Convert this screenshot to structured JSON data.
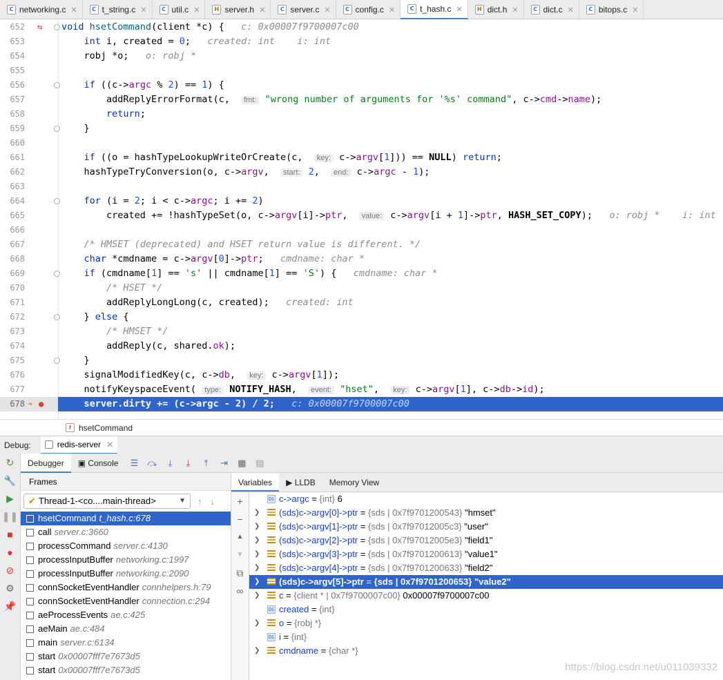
{
  "tabs": [
    {
      "label": "networking.c",
      "kind": "c"
    },
    {
      "label": "t_string.c",
      "kind": "c"
    },
    {
      "label": "util.c",
      "kind": "c"
    },
    {
      "label": "server.h",
      "kind": "h"
    },
    {
      "label": "server.c",
      "kind": "c"
    },
    {
      "label": "config.c",
      "kind": "c"
    },
    {
      "label": "t_hash.c",
      "kind": "c",
      "active": true
    },
    {
      "label": "dict.h",
      "kind": "h"
    },
    {
      "label": "dict.c",
      "kind": "c"
    },
    {
      "label": "bitops.c",
      "kind": "c"
    }
  ],
  "code": {
    "lines": [
      {
        "n": "652",
        "html": "<span class=\"k\">void</span> <span class=\"f\">hsetCommand</span>(client *c) {   <span class=\"inl\">c: 0x00007f9700007c00</span>"
      },
      {
        "n": "653",
        "html": "    <span class=\"k\">int</span> i, created = <span class=\"n\">0</span>;   <span class=\"inl\">created: int    i: int</span>"
      },
      {
        "n": "654",
        "html": "    robj *o;   <span class=\"inl\">o: robj *</span>"
      },
      {
        "n": "655",
        "html": ""
      },
      {
        "n": "656",
        "html": "    <span class=\"k\">if</span> ((c-><span class=\"m\">argc</span> % <span class=\"n\">2</span>) == <span class=\"n\">1</span>) {"
      },
      {
        "n": "657",
        "html": "        addReplyErrorFormat(c,  <span class=\"hint\">fmt:</span> <span class=\"s\">\"wrong number of arguments for '%s' command\"</span>, c-><span class=\"m\">cmd</span>-><span class=\"m\">name</span>);"
      },
      {
        "n": "658",
        "html": "        <span class=\"k\">return</span>;"
      },
      {
        "n": "659",
        "html": "    }"
      },
      {
        "n": "660",
        "html": ""
      },
      {
        "n": "661",
        "html": "    <span class=\"k\">if</span> ((o = hashTypeLookupWriteOrCreate(c,  <span class=\"hint\">key:</span> c-><span class=\"m\">argv</span>[<span class=\"n\">1</span>])) == <b>NULL</b>) <span class=\"k\">return</span>;"
      },
      {
        "n": "662",
        "html": "    hashTypeTryConversion(o, c-><span class=\"m\">argv</span>,  <span class=\"hint\">start:</span> <span class=\"n\">2</span>,  <span class=\"hint\">end:</span> c-><span class=\"m\">argc</span> - <span class=\"n\">1</span>);"
      },
      {
        "n": "663",
        "html": ""
      },
      {
        "n": "664",
        "html": "    <span class=\"k\">for</span> (i = <span class=\"n\">2</span>; i < c-><span class=\"m\">argc</span>; i += <span class=\"n\">2</span>)"
      },
      {
        "n": "665",
        "html": "        created += !hashTypeSet(o, c-><span class=\"m\">argv</span>[i]-><span class=\"m\">ptr</span>,  <span class=\"hint\">value:</span> c-><span class=\"m\">argv</span>[i + <span class=\"n\">1</span>]-><span class=\"m\">ptr</span>, <b>HASH_SET_COPY</b>);   <span class=\"inl\">o: robj *    i: int</span>"
      },
      {
        "n": "666",
        "html": ""
      },
      {
        "n": "667",
        "html": "    <span class=\"cm\">/* HMSET (deprecated) and HSET return value is different. */</span>"
      },
      {
        "n": "668",
        "html": "    <span class=\"k\">char</span> *cmdname = c-><span class=\"m\">argv</span>[<span class=\"n\">0</span>]-><span class=\"m\">ptr</span>;   <span class=\"inl\">cmdname: char *</span>"
      },
      {
        "n": "669",
        "html": "    <span class=\"k\">if</span> (cmdname[<span class=\"n\">1</span>] == <span class=\"s\">'s'</span> || cmdname[<span class=\"n\">1</span>] == <span class=\"s\">'S'</span>) {   <span class=\"inl\">cmdname: char *</span>"
      },
      {
        "n": "670",
        "html": "        <span class=\"cm\">/* HSET */</span>"
      },
      {
        "n": "671",
        "html": "        addReplyLongLong(c, created);   <span class=\"inl\">created: int</span>"
      },
      {
        "n": "672",
        "html": "    } <span class=\"k\">else</span> {"
      },
      {
        "n": "673",
        "html": "        <span class=\"cm\">/* HMSET */</span>"
      },
      {
        "n": "674",
        "html": "        addReply(c, shared.<span class=\"m\">ok</span>);"
      },
      {
        "n": "675",
        "html": "    }"
      },
      {
        "n": "676",
        "html": "    signalModifiedKey(c, c-><span class=\"m\">db</span>,  <span class=\"hint\">key:</span> c-><span class=\"m\">argv</span>[<span class=\"n\">1</span>]);"
      },
      {
        "n": "677",
        "html": "    notifyKeyspaceEvent( <span class=\"hint\">type:</span> <b>NOTIFY_HASH</b>,  <span class=\"hint\">event:</span> <span class=\"s\">\"hset\"</span>,  <span class=\"hint\">key:</span> c-><span class=\"m\">argv</span>[<span class=\"n\">1</span>], c-><span class=\"m\">db</span>-><span class=\"m\">id</span>);"
      },
      {
        "n": "678",
        "html": "    <b>server.dirty += (c->argc - 2) / 2;</b>   <span class=\"inl\">c: 0x00007f9700007c00</span>",
        "current": true
      }
    ]
  },
  "breadcrumb": {
    "fn": "hsetCommand"
  },
  "debug": {
    "label": "Debug:",
    "session": "redis-server"
  },
  "toolbar": {
    "debugger": "Debugger",
    "console": "Console"
  },
  "frames": {
    "header": "Frames",
    "thread": "Thread-1-<co....main-thread>",
    "items": [
      {
        "fn": "hsetCommand",
        "loc": "t_hash.c:678",
        "sel": true
      },
      {
        "fn": "call",
        "loc": "server.c:3660"
      },
      {
        "fn": "processCommand",
        "loc": "server.c:4130"
      },
      {
        "fn": "processInputBuffer",
        "loc": "networking.c:1997"
      },
      {
        "fn": "processInputBuffer",
        "loc": "networking.c:2090"
      },
      {
        "fn": "connSocketEventHandler",
        "loc": "connhelpers.h:79"
      },
      {
        "fn": "connSocketEventHandler",
        "loc": "connection.c:294"
      },
      {
        "fn": "aeProcessEvents",
        "loc": "ae.c:425"
      },
      {
        "fn": "aeMain",
        "loc": "ae.c:484"
      },
      {
        "fn": "main",
        "loc": "server.c:6134"
      },
      {
        "fn": "start",
        "loc": "0x00007fff7e7673d5"
      },
      {
        "fn": "start",
        "loc": "0x00007fff7e7673d5"
      }
    ]
  },
  "varTabs": [
    "Variables",
    "LLDB",
    "Memory View"
  ],
  "vars": [
    {
      "name": "c->argc",
      "type": "{int}",
      "val": "6",
      "icon": "p",
      "exp": false
    },
    {
      "name": "(sds)c->argv[0]->ptr",
      "type": "{sds | 0x7f9701200543}",
      "val": "\"hmset\"",
      "icon": "o",
      "exp": true
    },
    {
      "name": "(sds)c->argv[1]->ptr",
      "type": "{sds | 0x7f97012005c3}",
      "val": "\"user\"",
      "icon": "o",
      "exp": true
    },
    {
      "name": "(sds)c->argv[2]->ptr",
      "type": "{sds | 0x7f97012005e3}",
      "val": "\"field1\"",
      "icon": "o",
      "exp": true
    },
    {
      "name": "(sds)c->argv[3]->ptr",
      "type": "{sds | 0x7f9701200613}",
      "val": "\"value1\"",
      "icon": "o",
      "exp": true
    },
    {
      "name": "(sds)c->argv[4]->ptr",
      "type": "{sds | 0x7f9701200633}",
      "val": "\"field2\"",
      "icon": "o",
      "exp": true
    },
    {
      "name": "(sds)c->argv[5]->ptr",
      "type": "{sds | 0x7f9701200653}",
      "val": "\"value2\"",
      "icon": "o",
      "exp": true,
      "sel": true
    },
    {
      "name": "c",
      "type": "{client * | 0x7f9700007c00}",
      "val": "0x00007f9700007c00",
      "icon": "o",
      "exp": true
    },
    {
      "name": "created",
      "type": "{int}",
      "val": "",
      "icon": "p",
      "exp": false
    },
    {
      "name": "o",
      "type": "{robj *}",
      "val": "",
      "icon": "o",
      "exp": true
    },
    {
      "name": "i",
      "type": "{int}",
      "val": "",
      "icon": "p",
      "exp": false
    },
    {
      "name": "cmdname",
      "type": "{char *}",
      "val": "",
      "icon": "o",
      "exp": true
    }
  ],
  "watermark": "https://blog.csdn.net/u011039332"
}
